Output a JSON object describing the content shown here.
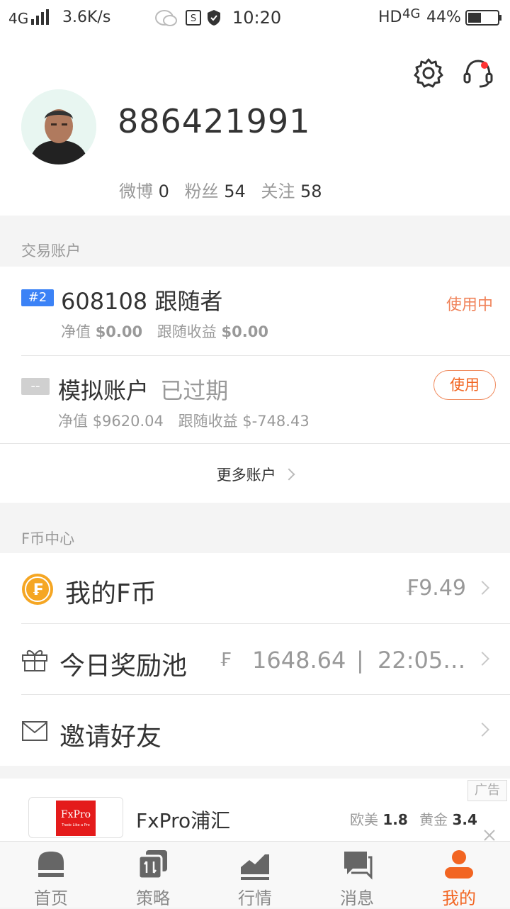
{
  "status_bar": {
    "network": "4G",
    "speed": "3.6K/s",
    "time": "10:20",
    "hd": "HD",
    "network_right": "4G",
    "battery": "44%"
  },
  "profile": {
    "username": "886421991",
    "stats": [
      {
        "label": "微博",
        "value": "0"
      },
      {
        "label": "粉丝",
        "value": "54"
      },
      {
        "label": "关注",
        "value": "58"
      }
    ]
  },
  "trading": {
    "section_title": "交易账户",
    "accounts": [
      {
        "badge": "#2",
        "name": "608108 跟随者",
        "status": "使用中",
        "net_label": "净值",
        "net_value": "$0.00",
        "earn_label": "跟随收益",
        "earn_value": "$0.00"
      },
      {
        "badge": "--",
        "name": "模拟账户",
        "expired": "已过期",
        "action": "使用",
        "net_label": "净值",
        "net_value": "$9620.04",
        "earn_label": "跟随收益",
        "earn_value": "$-748.43"
      }
    ],
    "more": "更多账户"
  },
  "fcoin": {
    "section_title": "F币中心",
    "my_fcoin": {
      "label": "我的F币",
      "value": "₣9.49"
    },
    "reward_pool": {
      "label": "今日奖励池",
      "symbol": "₣",
      "value": "1648.64",
      "separator": "|",
      "time": "22:05…"
    },
    "invite": {
      "label": "邀请好友"
    }
  },
  "ad": {
    "tag": "广告",
    "logo_text": "FxPro",
    "logo_sub": "Trade Like a Pro",
    "name": "FxPro浦汇",
    "quotes": [
      {
        "label": "欧美",
        "value": "1.8"
      },
      {
        "label": "黄金",
        "value": "3.4"
      }
    ]
  },
  "nav": {
    "items": [
      {
        "label": "首页"
      },
      {
        "label": "策略"
      },
      {
        "label": "行情"
      },
      {
        "label": "消息"
      },
      {
        "label": "我的"
      }
    ],
    "active_color": "#f26522"
  },
  "colors": {
    "accent": "#f26522",
    "badge_blue": "#3b82f6",
    "fcoin_gold": "#f5a623"
  }
}
